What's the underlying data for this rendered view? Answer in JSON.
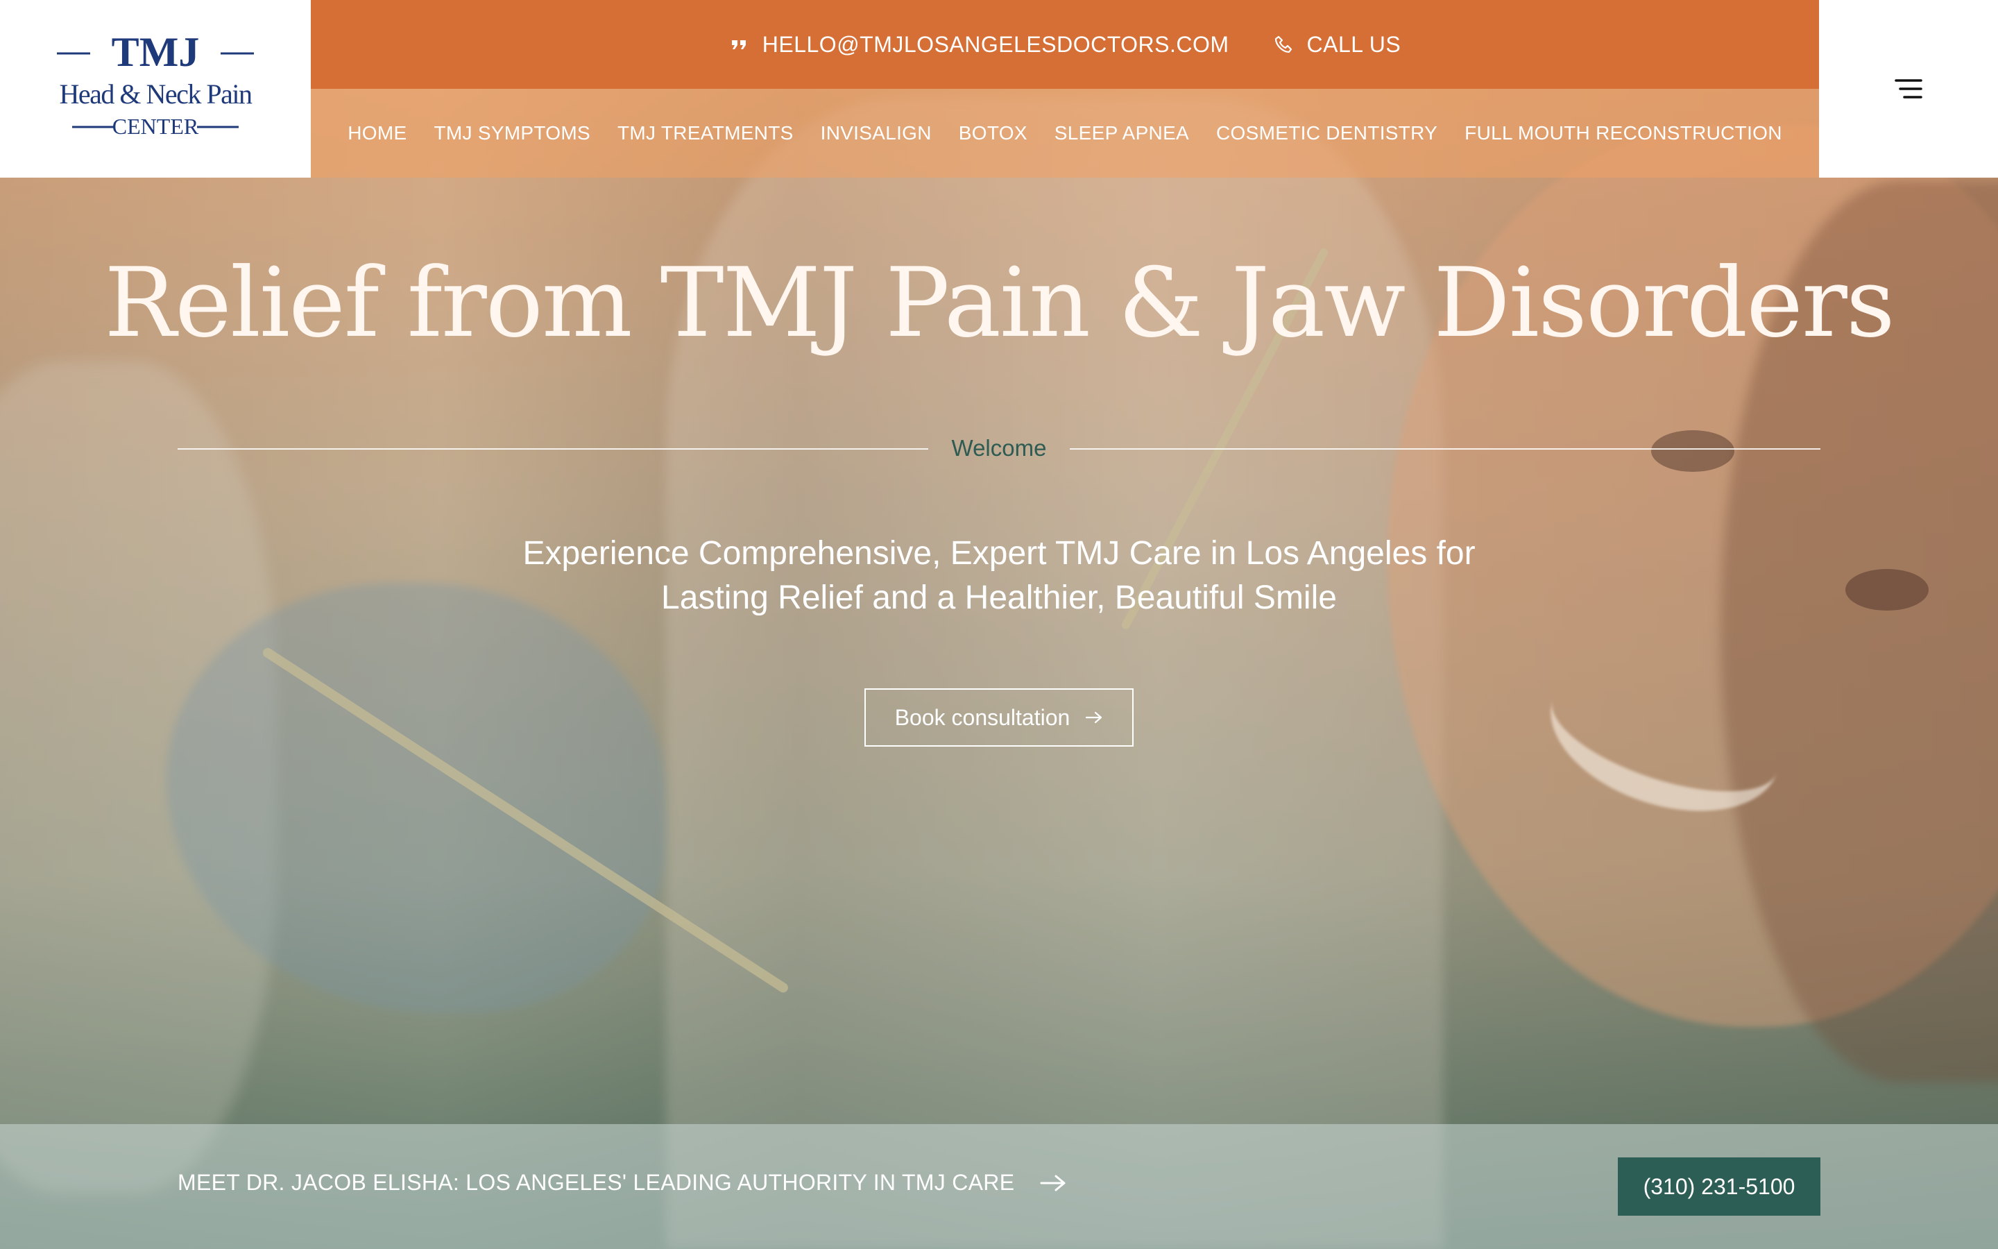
{
  "logo": {
    "line1": "TMJ",
    "line2": "Head & Neck Pain",
    "line3": "Center"
  },
  "topbar": {
    "email_icon": "quote-icon",
    "email": "HELLO@TMJLOSANGELESDOCTORS.COM",
    "call_icon": "phone-icon",
    "call_label": "CALL US"
  },
  "nav": {
    "items": [
      {
        "label": "HOME"
      },
      {
        "label": "TMJ SYMPTOMS"
      },
      {
        "label": "TMJ TREATMENTS"
      },
      {
        "label": "INVISALIGN"
      },
      {
        "label": "BOTOX"
      },
      {
        "label": "SLEEP APNEA"
      },
      {
        "label": "COSMETIC DENTISTRY"
      },
      {
        "label": "FULL MOUTH RECONSTRUCTION"
      }
    ],
    "menu_icon": "hamburger-menu-icon"
  },
  "hero": {
    "title": "Relief from TMJ Pain & Jaw Disorders",
    "eyebrow": "Welcome",
    "subtitle_line1": "Experience Comprehensive, Expert TMJ Care in Los Angeles for",
    "subtitle_line2": "Lasting Relief and a Healthier, Beautiful Smile",
    "cta_label": "Book consultation",
    "cta_icon": "arrow-right-icon"
  },
  "bottom_bar": {
    "meet_label": "MEET DR. JACOB ELISHA: LOS ANGELES' LEADING AUTHORITY IN TMJ CARE",
    "meet_icon": "arrow-right-icon",
    "phone": "(310) 231-5100"
  },
  "colors": {
    "topbar": "#d66f36",
    "navbar": "#f0a064",
    "logo_navy": "#1f3a7a",
    "accent_green": "#2d5e55",
    "white": "#ffffff"
  }
}
